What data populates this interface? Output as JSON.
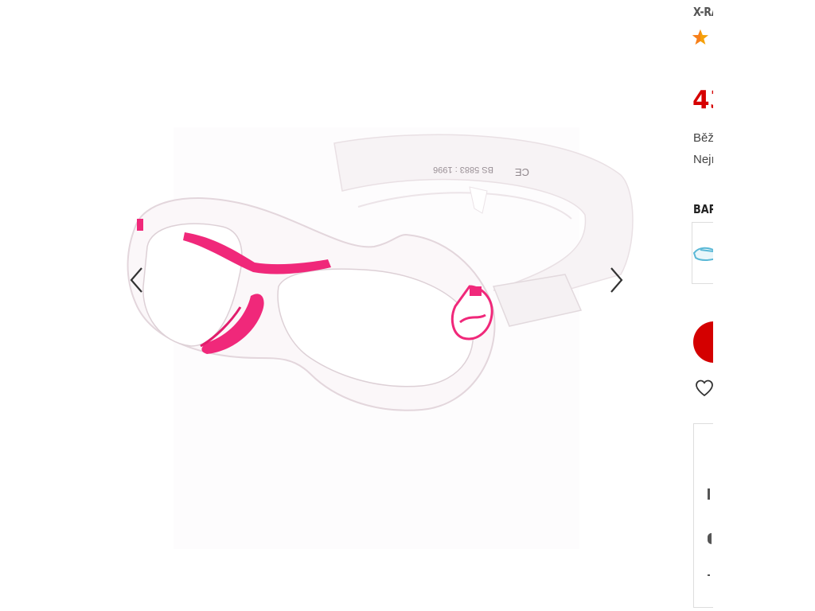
{
  "product": {
    "brand": "X-RA",
    "price": "43",
    "regular_price_label": "Běž",
    "lowest_price_label": "Nejı",
    "color_heading": "BAR"
  },
  "gallery": {
    "prev_icon": "chevron-left-icon",
    "next_icon": "chevron-right-icon",
    "image_strap_text": "BS 5883 : 1996",
    "image_mark_text": "CE"
  },
  "icons": {
    "rating": "star-icon",
    "wishlist": "heart-outline-icon",
    "cart": "cart-button"
  },
  "colors": {
    "price": "#d60000",
    "accent_pink": "#f0287a",
    "button_red": "#d40000",
    "swatch_tint": "#5ab8d6"
  }
}
